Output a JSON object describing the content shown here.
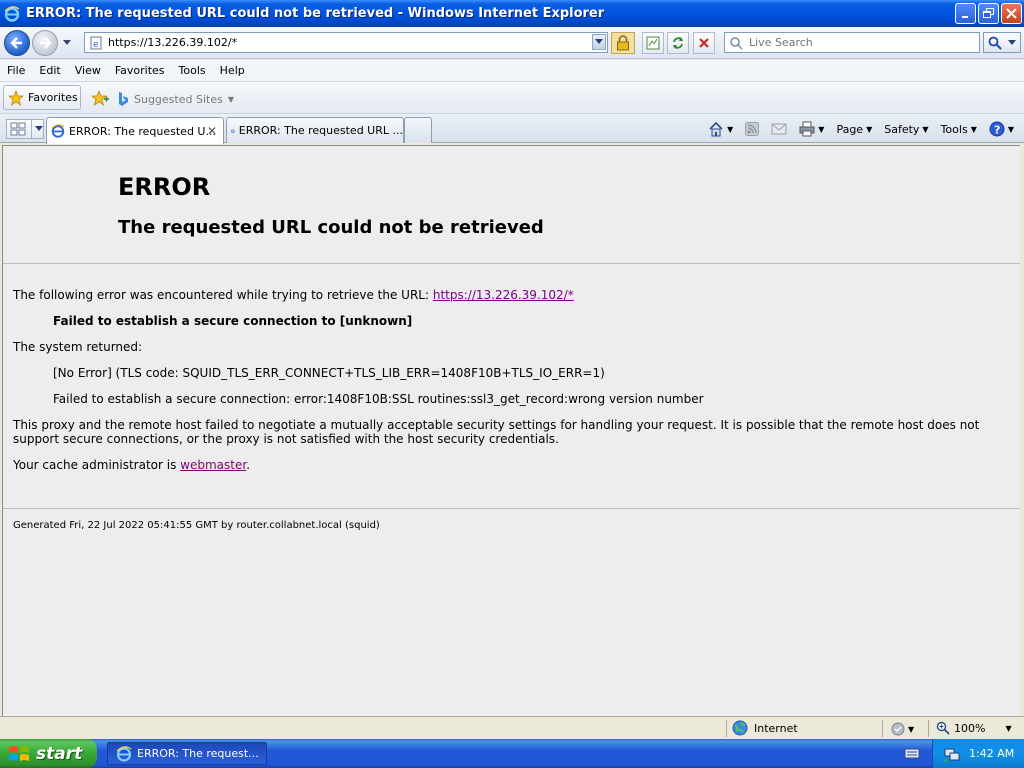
{
  "window": {
    "title": "ERROR: The requested URL could not be retrieved - Windows Internet Explorer"
  },
  "address_bar": {
    "url": "https://13.226.39.102/*",
    "search_placeholder": "Live Search"
  },
  "menu": {
    "items": [
      "File",
      "Edit",
      "View",
      "Favorites",
      "Tools",
      "Help"
    ]
  },
  "favorites_bar": {
    "favorites_label": "Favorites",
    "suggested_label": "Suggested Sites"
  },
  "tabs": [
    {
      "label": "ERROR: The requested U...",
      "active": true
    },
    {
      "label": "ERROR: The requested URL ...",
      "active": false
    }
  ],
  "command_bar": {
    "page_label": "Page",
    "safety_label": "Safety",
    "tools_label": "Tools"
  },
  "page": {
    "heading": "ERROR",
    "subheading": "The requested URL could not be retrieved",
    "intro_text": "The following error was encountered while trying to retrieve the URL:",
    "intro_link": "https://13.226.39.102/*",
    "failed_text": "Failed to establish a secure connection to [unknown]",
    "system_returned": "The system returned:",
    "error_code": "[No Error] (TLS code: SQUID_TLS_ERR_CONNECT+TLS_LIB_ERR=1408F10B+TLS_IO_ERR=1)",
    "error_detail": "Failed to establish a secure connection: error:1408F10B:SSL routines:ssl3_get_record:wrong version number",
    "explanation": "This proxy and the remote host failed to negotiate a mutually acceptable security settings for handling your request. It is possible that the remote host does not support secure connections, or the proxy is not satisfied with the host security credentials.",
    "admin_prefix": "Your cache administrator is ",
    "admin_link": "webmaster",
    "admin_suffix": ".",
    "footer": "Generated Fri, 22 Jul 2022 05:41:55 GMT by router.collabnet.local (squid)"
  },
  "status_bar": {
    "zone": "Internet",
    "zoom": "100%"
  },
  "taskbar": {
    "start_label": "start",
    "task_label": "ERROR: The request...",
    "clock": "1:42 AM"
  },
  "colors": {
    "titlebar": "#0054e3",
    "link_visited": "#800080",
    "page_bg": "#ededed",
    "taskbar": "#2157d7",
    "start_button": "#38a838"
  }
}
